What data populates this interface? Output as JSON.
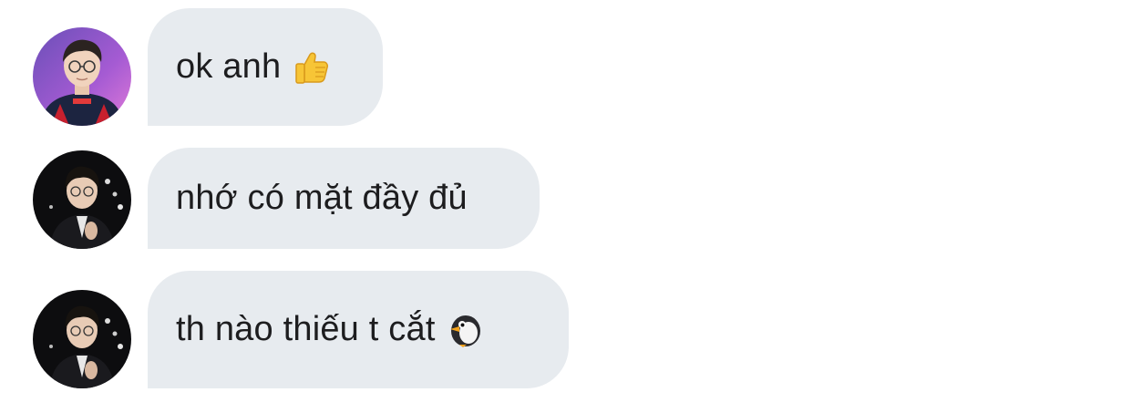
{
  "messages": [
    {
      "sender_avatar": "avatar-user-jersey",
      "text": "ok anh",
      "emoji": "thumbs-up-icon"
    },
    {
      "sender_avatar": "avatar-user-dark",
      "text": "nhớ có mặt đầy đủ",
      "emoji": ""
    },
    {
      "sender_avatar": "avatar-user-dark",
      "text": "th nào thiếu t cắt",
      "emoji": "penguin-icon"
    }
  ],
  "colors": {
    "bubble": "#e7ebef",
    "text": "#1d1d1f",
    "background": "#ffffff"
  }
}
